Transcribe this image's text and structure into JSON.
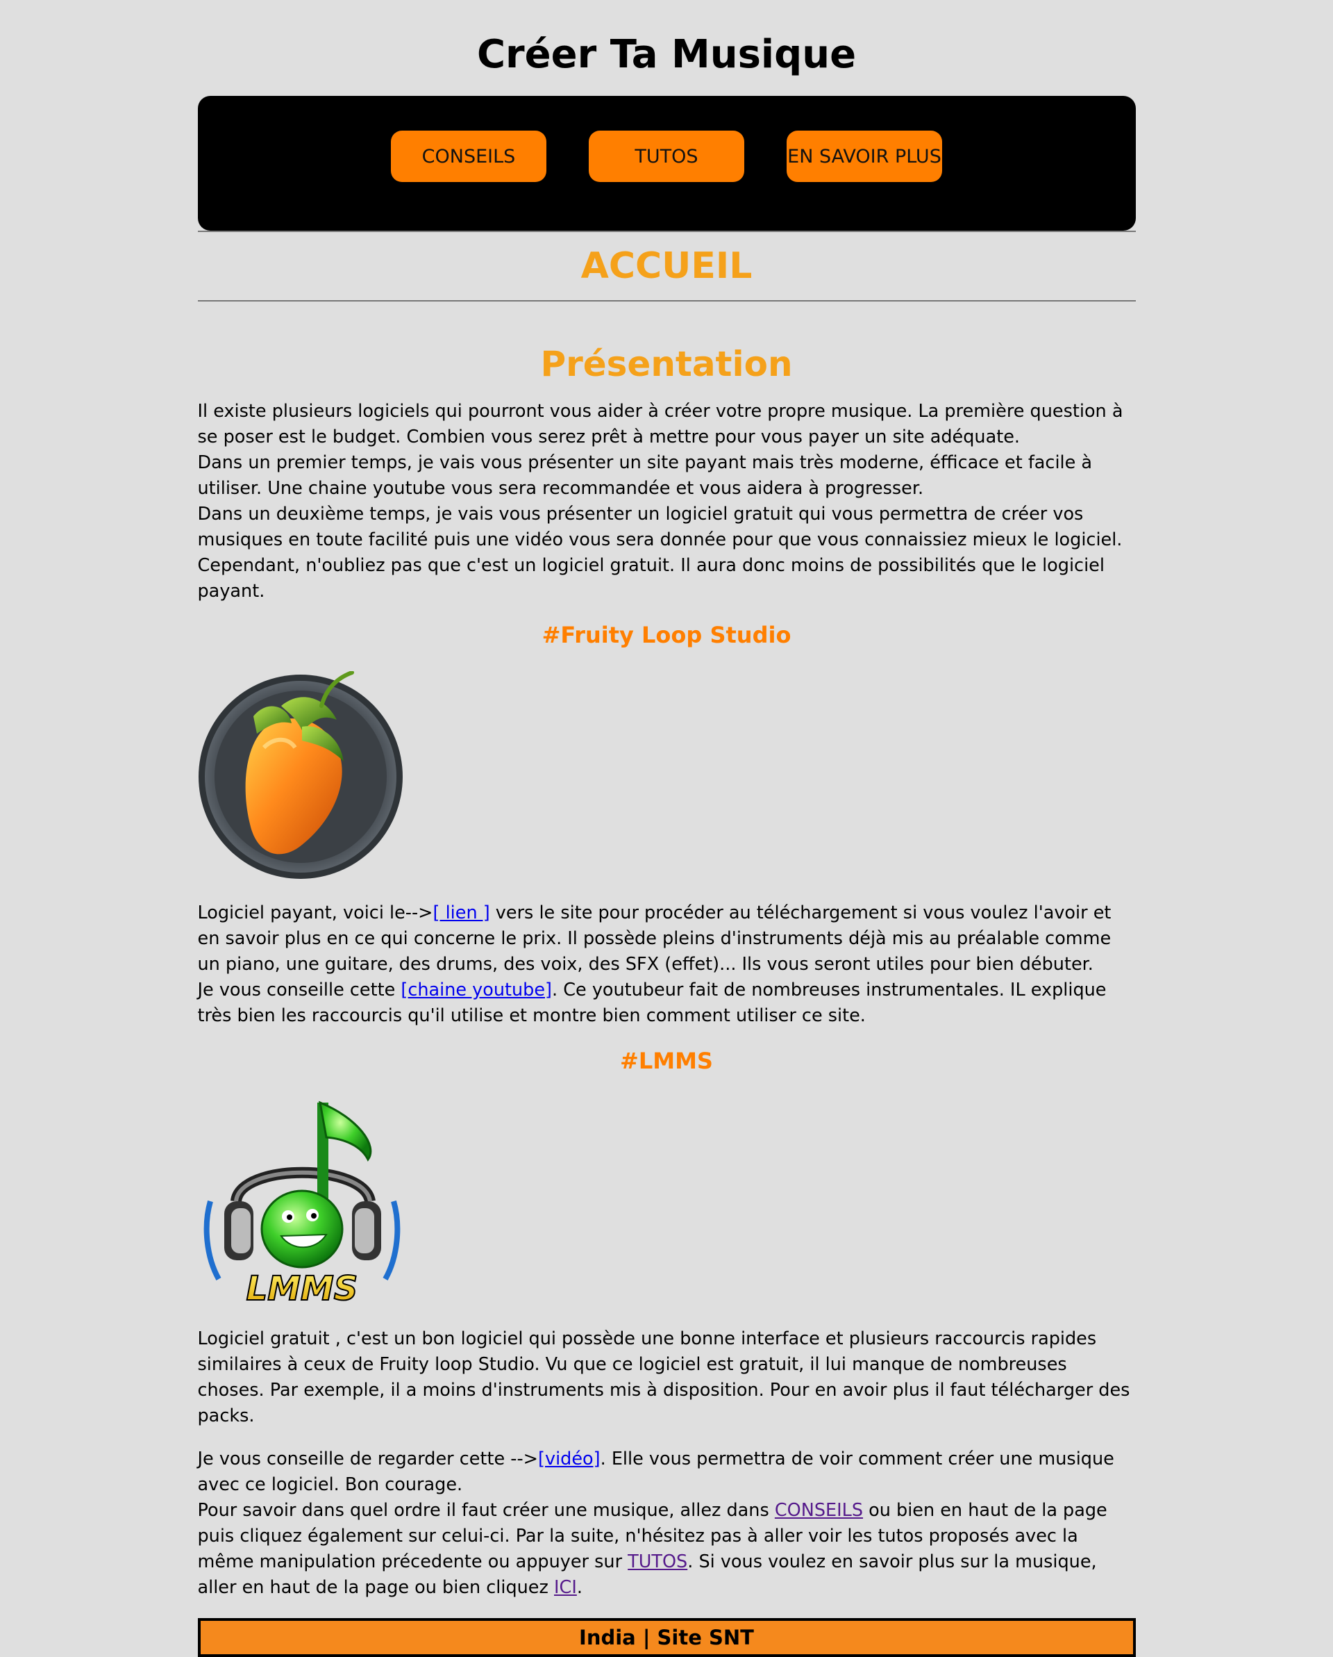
{
  "header": {
    "title": "Créer Ta Musique"
  },
  "nav": {
    "items": [
      {
        "label": "CONSEILS"
      },
      {
        "label": "TUTOS"
      },
      {
        "label": "EN SAVOIR PLUS"
      }
    ]
  },
  "colors": {
    "background": "#dfdfdf",
    "nav_bg": "#000000",
    "button": "#ff7f00",
    "heading": "#f5a11a",
    "footer": "#f5891d"
  },
  "section": {
    "title": "ACCUEIL"
  },
  "presentation": {
    "title": "Présentation",
    "lines": [
      "Il existe plusieurs logiciels qui pourront vous aider à créer votre propre musique. La première question à se poser est le budget. Combien vous serez prêt à mettre pour vous payer un site adéquate.",
      "Dans un premier temps, je vais vous présenter un site payant mais très moderne, éfficace et facile à utiliser. Une chaine youtube vous sera recommandée et vous aidera à progresser.",
      "Dans un deuxième temps, je vais vous présenter un logiciel gratuit qui vous permettra de créer vos musiques en toute facilité puis une vidéo vous sera donnée pour que vous connaissiez mieux le logiciel.",
      "Cependant, n'oubliez pas que c'est un logiciel gratuit. Il aura donc moins de possibilités que le logiciel payant."
    ]
  },
  "fl": {
    "title": "#Fruity Loop Studio",
    "logo_icon": "fl-studio-logo-icon",
    "p1_before": "Logiciel payant, voici le-->",
    "p1_link": "[ lien ]",
    "p1_after": " vers le site pour procéder au téléchargement si vous voulez l'avoir et en savoir plus en ce qui concerne le prix. Il possède pleins d'instruments déjà mis au préalable comme un piano, une guitare, des drums, des voix, des SFX (effet)... Ils vous seront utiles pour bien débuter.",
    "p2_before": "Je vous conseille cette ",
    "p2_link": "[chaine youtube]",
    "p2_after": ". Ce youtubeur fait de nombreuses instrumentales. IL explique très bien les raccourcis qu'il utilise et montre bien comment utiliser ce site."
  },
  "lmms": {
    "title": "#LMMS",
    "logo_icon": "lmms-logo-icon",
    "logo_text": "LMMS",
    "p1": "Logiciel gratuit , c'est un bon logiciel qui possède une bonne interface et plusieurs raccourcis rapides similaires à ceux de Fruity loop Studio. Vu que ce logiciel est gratuit, il lui manque de nombreuses choses. Par exemple, il a moins d'instruments mis à disposition. Pour en avoir plus il faut télécharger des packs.",
    "p2_before": "Je vous conseille de regarder cette -->",
    "p2_link": "[vidéo]",
    "p2_after": ". Elle vous permettra de voir comment créer une musique avec ce logiciel. Bon courage.",
    "p3_a": "Pour savoir dans quel ordre il faut créer une musique, allez dans ",
    "p3_link1": "CONSEILS",
    "p3_b": " ou bien en haut de la page puis cliquez également sur celui-ci. Par la suite, n'hésitez pas à aller voir les tutos proposés avec la même manipulation précedente ou appuyer sur ",
    "p3_link2": "TUTOS",
    "p3_c": ". Si vous voulez en savoir plus sur la musique, aller en haut de la page ou bien cliquez ",
    "p3_link3": "ICI",
    "p3_d": "."
  },
  "footer": {
    "text": "India | Site SNT"
  }
}
